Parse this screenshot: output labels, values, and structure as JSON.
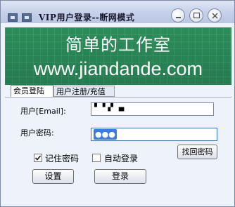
{
  "window": {
    "title": "VIP用户登录--断网模式"
  },
  "banner": {
    "title": "简单的工作室",
    "url": "www.jiandande.com"
  },
  "tabs": [
    {
      "label": "会员登陆",
      "active": true
    },
    {
      "label": "用户注册/充值",
      "active": false
    }
  ],
  "form": {
    "username_label": "用户[Email]:",
    "username_value": "▘▝▗▘▗▖",
    "password_label": "用户密码:",
    "password_mask": "●●●",
    "recover_button": "找回密码",
    "remember_label": "记住密码",
    "remember_checked": true,
    "autologin_label": "自动登录",
    "autologin_checked": false,
    "settings_button": "设置",
    "login_button": "登录"
  },
  "colors": {
    "banner_bg": "#2d8c5a",
    "focus_border": "#3a6fd8",
    "password_highlight": "#3a7be6"
  }
}
